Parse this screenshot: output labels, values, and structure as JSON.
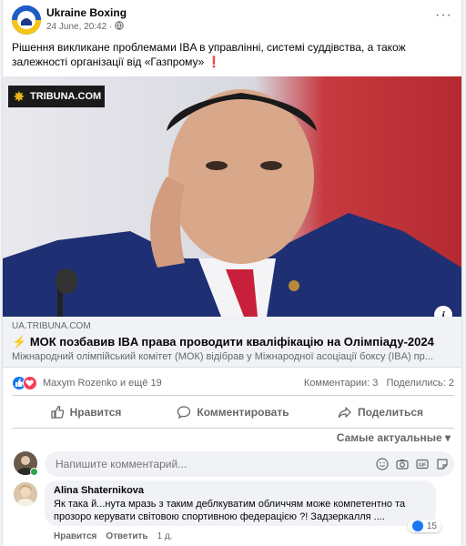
{
  "post": {
    "page_name": "Ukraine Boxing",
    "date": "24 June, 20:42",
    "separator": "·",
    "audience_icon": "globe-icon",
    "more_label": "···",
    "text": "Рішення викликане проблемами IBA в управлінні, системі суддівства, а також залежності організації від «Газпрому»",
    "text_emoji": "❗",
    "media_watermark": "TRIBUNA.COM"
  },
  "link": {
    "domain": "UA.TRIBUNA.COM",
    "title_emoji": "⚡",
    "title": "МОК позбавив IBA права проводити кваліфікацію на Олімпіаду-2024",
    "description": "Міжнародний олімпійський комітет (МОК) відібрав у Міжнародної асоціації боксу (IBA) пр...",
    "info_label": "i"
  },
  "stats": {
    "reactors": "Maxym Rozenko и ещё 19",
    "comments": "Комментарии: 3",
    "shares": "Поделились: 2"
  },
  "actions": {
    "like": "Нравится",
    "comment": "Комментировать",
    "share": "Поделиться"
  },
  "sort_label": "Самые актуальные ▾",
  "comment_input": {
    "placeholder": "Напишите комментарий..."
  },
  "comment": {
    "author": "Alina Shaternikova",
    "text": "Як така й...нута мразь з таким деблкуватим обличчям може компетентно та прозоро керувати світовою спортивною федерацією ?! Задзеркалля ....",
    "likes": "15",
    "like_label": "Нравится",
    "reply_label": "Ответить",
    "time": "1 д."
  },
  "colors": {
    "accent": "#1877f2",
    "secondary_text": "#65676b",
    "love": "#f33e58"
  }
}
